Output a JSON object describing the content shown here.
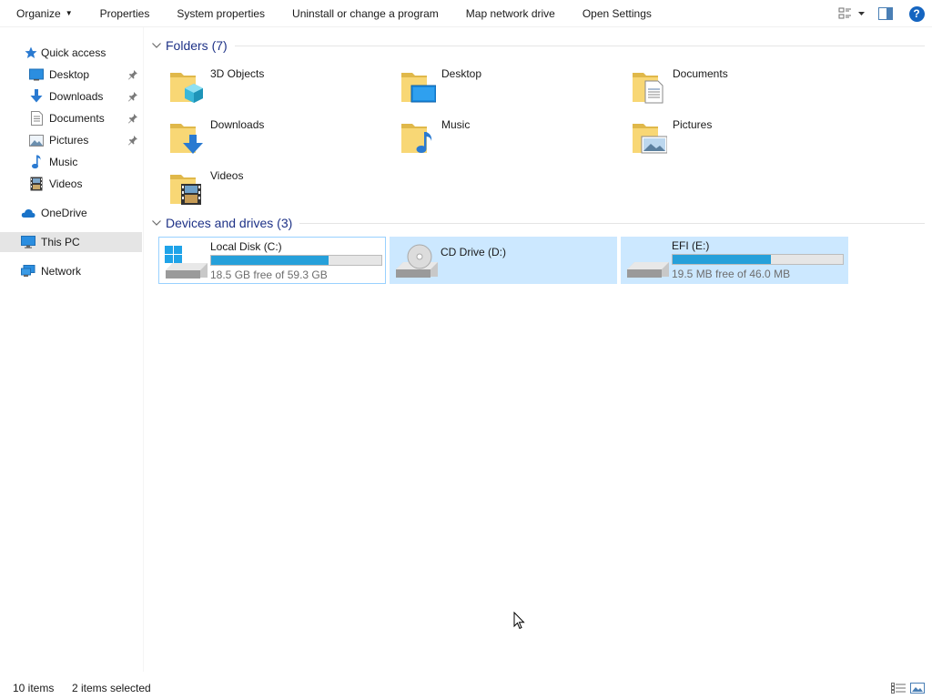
{
  "toolbar": {
    "organize": "Organize",
    "properties": "Properties",
    "system_properties": "System properties",
    "uninstall": "Uninstall or change a program",
    "map_drive": "Map network drive",
    "open_settings": "Open Settings",
    "help": "?"
  },
  "sidebar": {
    "quick_access": "Quick access",
    "items": [
      {
        "label": "Desktop",
        "icon": "desktop-icon",
        "pinned": true
      },
      {
        "label": "Downloads",
        "icon": "downloads-icon",
        "pinned": true
      },
      {
        "label": "Documents",
        "icon": "documents-icon",
        "pinned": true
      },
      {
        "label": "Pictures",
        "icon": "pictures-icon",
        "pinned": true
      },
      {
        "label": "Music",
        "icon": "music-icon",
        "pinned": false
      },
      {
        "label": "Videos",
        "icon": "videos-icon",
        "pinned": false
      }
    ],
    "onedrive": "OneDrive",
    "this_pc": "This PC",
    "network": "Network"
  },
  "folders": {
    "header": "Folders (7)",
    "items": [
      {
        "name": "3D Objects",
        "overlay": "cube"
      },
      {
        "name": "Desktop",
        "overlay": "screen"
      },
      {
        "name": "Documents",
        "overlay": "doc"
      },
      {
        "name": "Downloads",
        "overlay": "arrow"
      },
      {
        "name": "Music",
        "overlay": "note"
      },
      {
        "name": "Pictures",
        "overlay": "photo"
      },
      {
        "name": "Videos",
        "overlay": "film"
      }
    ]
  },
  "drives": {
    "header": "Devices and drives (3)",
    "items": [
      {
        "name": "Local Disk (C:)",
        "free": "18.5 GB free of 59.3 GB",
        "used_fraction": 0.69,
        "state": "focused",
        "type": "windows"
      },
      {
        "name": "CD Drive (D:)",
        "free": "",
        "used_fraction": null,
        "state": "selected",
        "type": "cd"
      },
      {
        "name": "EFI (E:)",
        "free": "19.5 MB free of 46.0 MB",
        "used_fraction": 0.58,
        "state": "selected",
        "type": "disk"
      }
    ]
  },
  "status": {
    "count": "10 items",
    "selected": "2 items selected"
  },
  "colors": {
    "selection": "#cce8ff",
    "progress": "#26a0da",
    "group_title": "#1e3287",
    "folder": "#f8d775"
  }
}
